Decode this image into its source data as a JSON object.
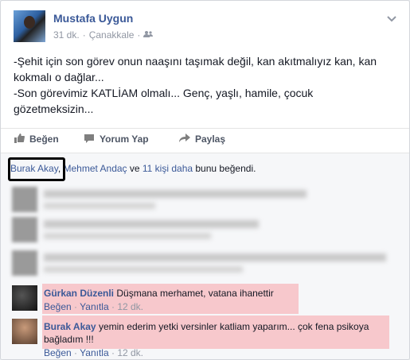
{
  "post": {
    "author": "Mustafa Uygun",
    "time": "31 dk.",
    "location": "Çanakkale",
    "privacy_icon": "friends-icon",
    "lines": [
      "-Şehit için son görev onun naaşını taşımak değil, kan akıtmalıyız kan, kan",
      "kokmalı o dağlar...",
      "-Son görevimiz KATLİAM olmalı... Genç, yaşlı, hamile, çocuk",
      "gözetmeksizin..."
    ]
  },
  "actions": {
    "like": "Beğen",
    "comment": "Yorum Yap",
    "share": "Paylaş"
  },
  "likes": {
    "name1": "Burak Akay",
    "comma": ",",
    "name2": "Mehmet Andaç",
    "and": " ve ",
    "others": "11 kişi daha",
    "suffix": " bunu beğendi."
  },
  "comments": [
    {
      "name": "Gürkan Düzenli",
      "text": "Düşmana merhamet, vatana ihanettir",
      "like": "Beğen",
      "reply": "Yanıtla",
      "time": "12 dk."
    },
    {
      "name": "Burak Akay",
      "text": "yemin ederim yetki versinler katliam yaparım... çok fena psikoya",
      "text2": "bağladım !!!",
      "like": "Beğen",
      "reply": "Yanıtla",
      "time": "12 dk."
    }
  ],
  "dot": "·",
  "colors": {
    "link": "#3b5998",
    "highlight": "#f7c8cc"
  }
}
